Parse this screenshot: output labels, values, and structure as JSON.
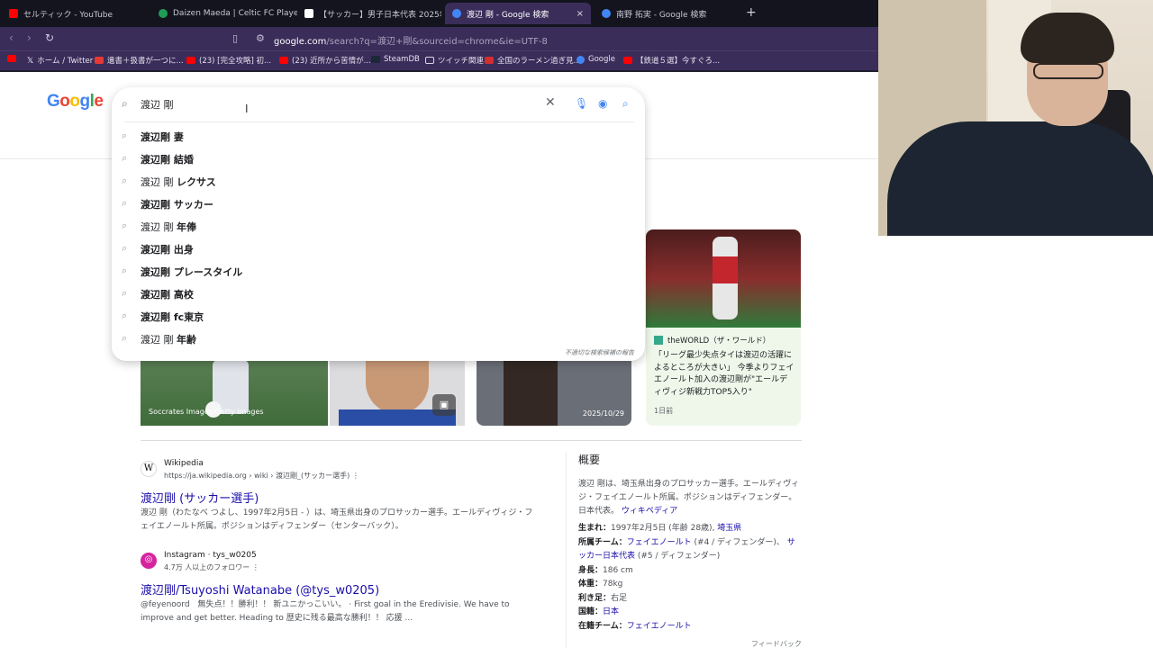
{
  "browser": {
    "tabs": [
      {
        "label": "セルティック - YouTube",
        "color": "#ff0000"
      },
      {
        "label": "Daizen Maeda | Celtic FC Player Profi",
        "color": "#1f9d55"
      },
      {
        "label": "【サッカー】男子日本代表 2025年最新メ",
        "color": "#ffffff"
      },
      {
        "label": "渡辺 剛 - Google 検索",
        "color": "#4285f4"
      },
      {
        "label": "南野 拓実 - Google 検索",
        "color": "#4285f4"
      }
    ],
    "tab_close": "×",
    "new_tab": "+",
    "url_host": "google.com",
    "url_rest": "/search?q=渡辺+剛&sourceid=chrome&ie=UTF-8",
    "bookmarks": [
      {
        "label": "",
        "color": "#ff0000"
      },
      {
        "label": "ホーム / Twitter",
        "color": "#ffffff"
      },
      {
        "label": "遺書＋扱書が一つに...",
        "color": "#e53935"
      },
      {
        "label": "(23) [完全攻略] 初...",
        "color": "#ff0000"
      },
      {
        "label": "(23) 近所から苦情が...",
        "color": "#ff0000"
      },
      {
        "label": "SteamDB",
        "color": "#1b2838"
      },
      {
        "label": "ツイッチ関連",
        "color": "#f5c518"
      },
      {
        "label": "全国のラーメン過ぎ見...",
        "color": "#d32f2f"
      },
      {
        "label": "Google",
        "color": "#4285f4"
      },
      {
        "label": "【鉄道５選】今すぐろ...",
        "color": "#ff0000"
      }
    ]
  },
  "google": {
    "logo_letters": [
      {
        "ch": "G",
        "color": "#4285f4"
      },
      {
        "ch": "o",
        "color": "#ea4335"
      },
      {
        "ch": "o",
        "color": "#fbbc05"
      },
      {
        "ch": "g",
        "color": "#4285f4"
      },
      {
        "ch": "l",
        "color": "#34a853"
      },
      {
        "ch": "e",
        "color": "#ea4335"
      }
    ],
    "query": "渡辺 剛",
    "suggestions": [
      {
        "light": "渡辺剛 ",
        "bold": "妻",
        "all_bold": true
      },
      {
        "light": "渡辺剛 ",
        "bold": "結婚",
        "all_bold": true
      },
      {
        "light": "渡辺 剛 ",
        "bold": "レクサス",
        "all_bold": false
      },
      {
        "light": "渡辺剛 ",
        "bold": "サッカー",
        "all_bold": true
      },
      {
        "light": "渡辺 剛 ",
        "bold": "年俸",
        "all_bold": false
      },
      {
        "light": "渡辺剛 ",
        "bold": "出身",
        "all_bold": true
      },
      {
        "light": "渡辺剛 ",
        "bold": "プレースタイル",
        "all_bold": true
      },
      {
        "light": "渡辺剛 ",
        "bold": "高校",
        "all_bold": true
      },
      {
        "light": "渡辺剛 ",
        "bold": "fc東京",
        "all_bold": true
      },
      {
        "light": "渡辺 剛 ",
        "bold": "年齢",
        "all_bold": false
      }
    ],
    "report_text": "不適切な検索候補の報告"
  },
  "images": {
    "credit": "Soccrates Images/Getty Images",
    "date": "2025/10/29"
  },
  "news": {
    "source": "theWORLD（ザ・ワールド）",
    "headline": "「リーグ最少失点タイは渡辺の活躍によるところが大きい」 今季よりフェイエノールト加入の渡辺剛が\"エールディヴィジ新戦力TOP5入り\"",
    "ago": "1日前"
  },
  "results": [
    {
      "icon": "W",
      "site": "Wikipedia",
      "url": "https://ja.wikipedia.org › wiki › 渡辺剛_(サッカー選手)",
      "title": "渡辺剛 (サッカー選手)",
      "snippet": "渡辺 剛（わたなべ つよし、1997年2月5日 - ）は、埼玉県出身のプロサッカー選手。エールディヴィジ・フェイエノールト所属。ポジションはディフェンダー（センターバック）。"
    },
    {
      "icon": "◎",
      "site": "Instagram · tys_w0205",
      "url": "4.7万 人以上のフォロワー",
      "title": "渡辺剛/Tsuyoshi Watanabe (@tys_w0205)",
      "snippet": "@feyenoord　無失点！！勝利！！ 新ユニかっこいい。 · First goal in the Eredivisie. We have to improve and get better. Heading to 歴史に残る最高な勝利！！ 応援 ..."
    }
  ],
  "knowledge": {
    "title": "概要",
    "desc": "渡辺 剛は、埼玉県出身のプロサッカー選手。エールディヴィジ・フェイエノールト所属。ポジションはディフェンダー。日本代表。",
    "wiki_link": "ウィキペディア",
    "facts": [
      {
        "k": "生まれ：",
        "v": "1997年2月5日 (年齢 28歳), ",
        "link": "埼玉県"
      },
      {
        "k": "所属チーム：",
        "v": "",
        "link": "フェイエノールト",
        "v2": " (#4 / ディフェンダー)、 ",
        "link2": "サッカー日本代表",
        "v3": " (#5 / ディフェンダー)"
      },
      {
        "k": "身長：",
        "v": "186 cm"
      },
      {
        "k": "体重：",
        "v": "78kg"
      },
      {
        "k": "利き足：",
        "v": "右足"
      },
      {
        "k": "国籍：",
        "v": "",
        "link": "日本"
      },
      {
        "k": "在籍チーム：",
        "v": "",
        "link": "フェイエノールト"
      }
    ],
    "feedback": "フィードバック"
  }
}
